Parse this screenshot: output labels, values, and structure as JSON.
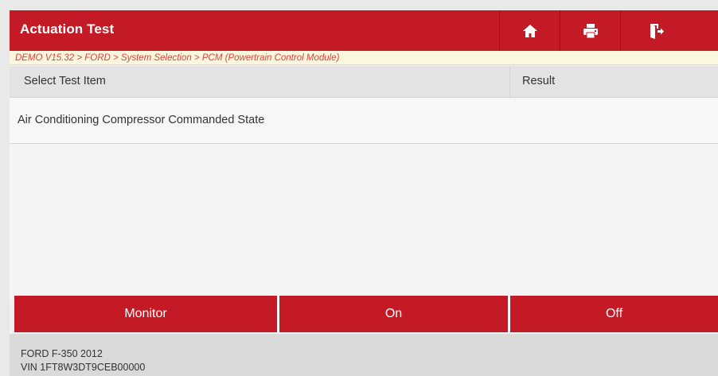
{
  "header": {
    "title": "Actuation Test",
    "buttons": [
      {
        "name": "home-icon"
      },
      {
        "name": "print-icon"
      },
      {
        "name": "exit-icon"
      }
    ]
  },
  "breadcrumb": "DEMO V15.32 > FORD > System Selection > PCM (Powertrain Control Module)",
  "table": {
    "columns": [
      "Select Test Item",
      "Result"
    ],
    "rows": [
      {
        "item": "Air Conditioning Compressor Commanded State",
        "result": ""
      }
    ]
  },
  "actions": [
    "Monitor",
    "On",
    "Off"
  ],
  "footer": {
    "vehicle": "FORD F-350 2012",
    "vin": "VIN 1FT8W3DT9CEB00000"
  },
  "colors": {
    "accent": "#c41a26",
    "breadcrumb_text": "#e0413b",
    "breadcrumb_bg": "#fbf7df"
  }
}
